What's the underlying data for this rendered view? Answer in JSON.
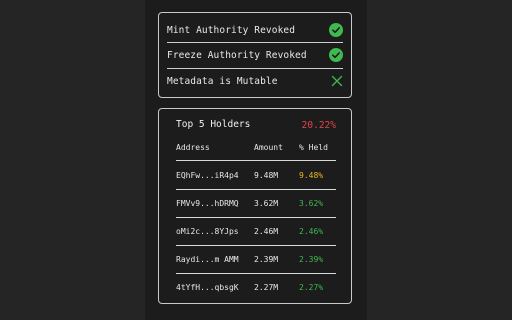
{
  "checks": [
    {
      "label": "Mint Authority Revoked",
      "status": "pass",
      "icon": "check-circle-icon"
    },
    {
      "label": "Freeze Authority Revoked",
      "status": "pass",
      "icon": "check-circle-icon"
    },
    {
      "label": "Metadata is Mutable",
      "status": "fail",
      "icon": "x-icon"
    }
  ],
  "holders": {
    "title": "Top 5 Holders",
    "total_percent": "20.22%",
    "columns": {
      "address": "Address",
      "amount": "Amount",
      "held": "% Held"
    },
    "rows": [
      {
        "address": "EQhFw...iR4p4",
        "amount": "9.48M",
        "held": "9.48%"
      },
      {
        "address": "FMVv9...hDRMQ",
        "amount": "3.62M",
        "held": "3.62%"
      },
      {
        "address": "oMi2c...8YJps",
        "amount": "2.46M",
        "held": "2.46%"
      },
      {
        "address": "Raydi...m AMM",
        "amount": "2.39M",
        "held": "2.39%"
      },
      {
        "address": "4tYfH...qbsgK",
        "amount": "2.27M",
        "held": "2.27%"
      }
    ]
  },
  "colors": {
    "pass": "#3fb950",
    "fail": "#3fb950",
    "warning": "#e8b71a",
    "danger": "#e0454a"
  }
}
